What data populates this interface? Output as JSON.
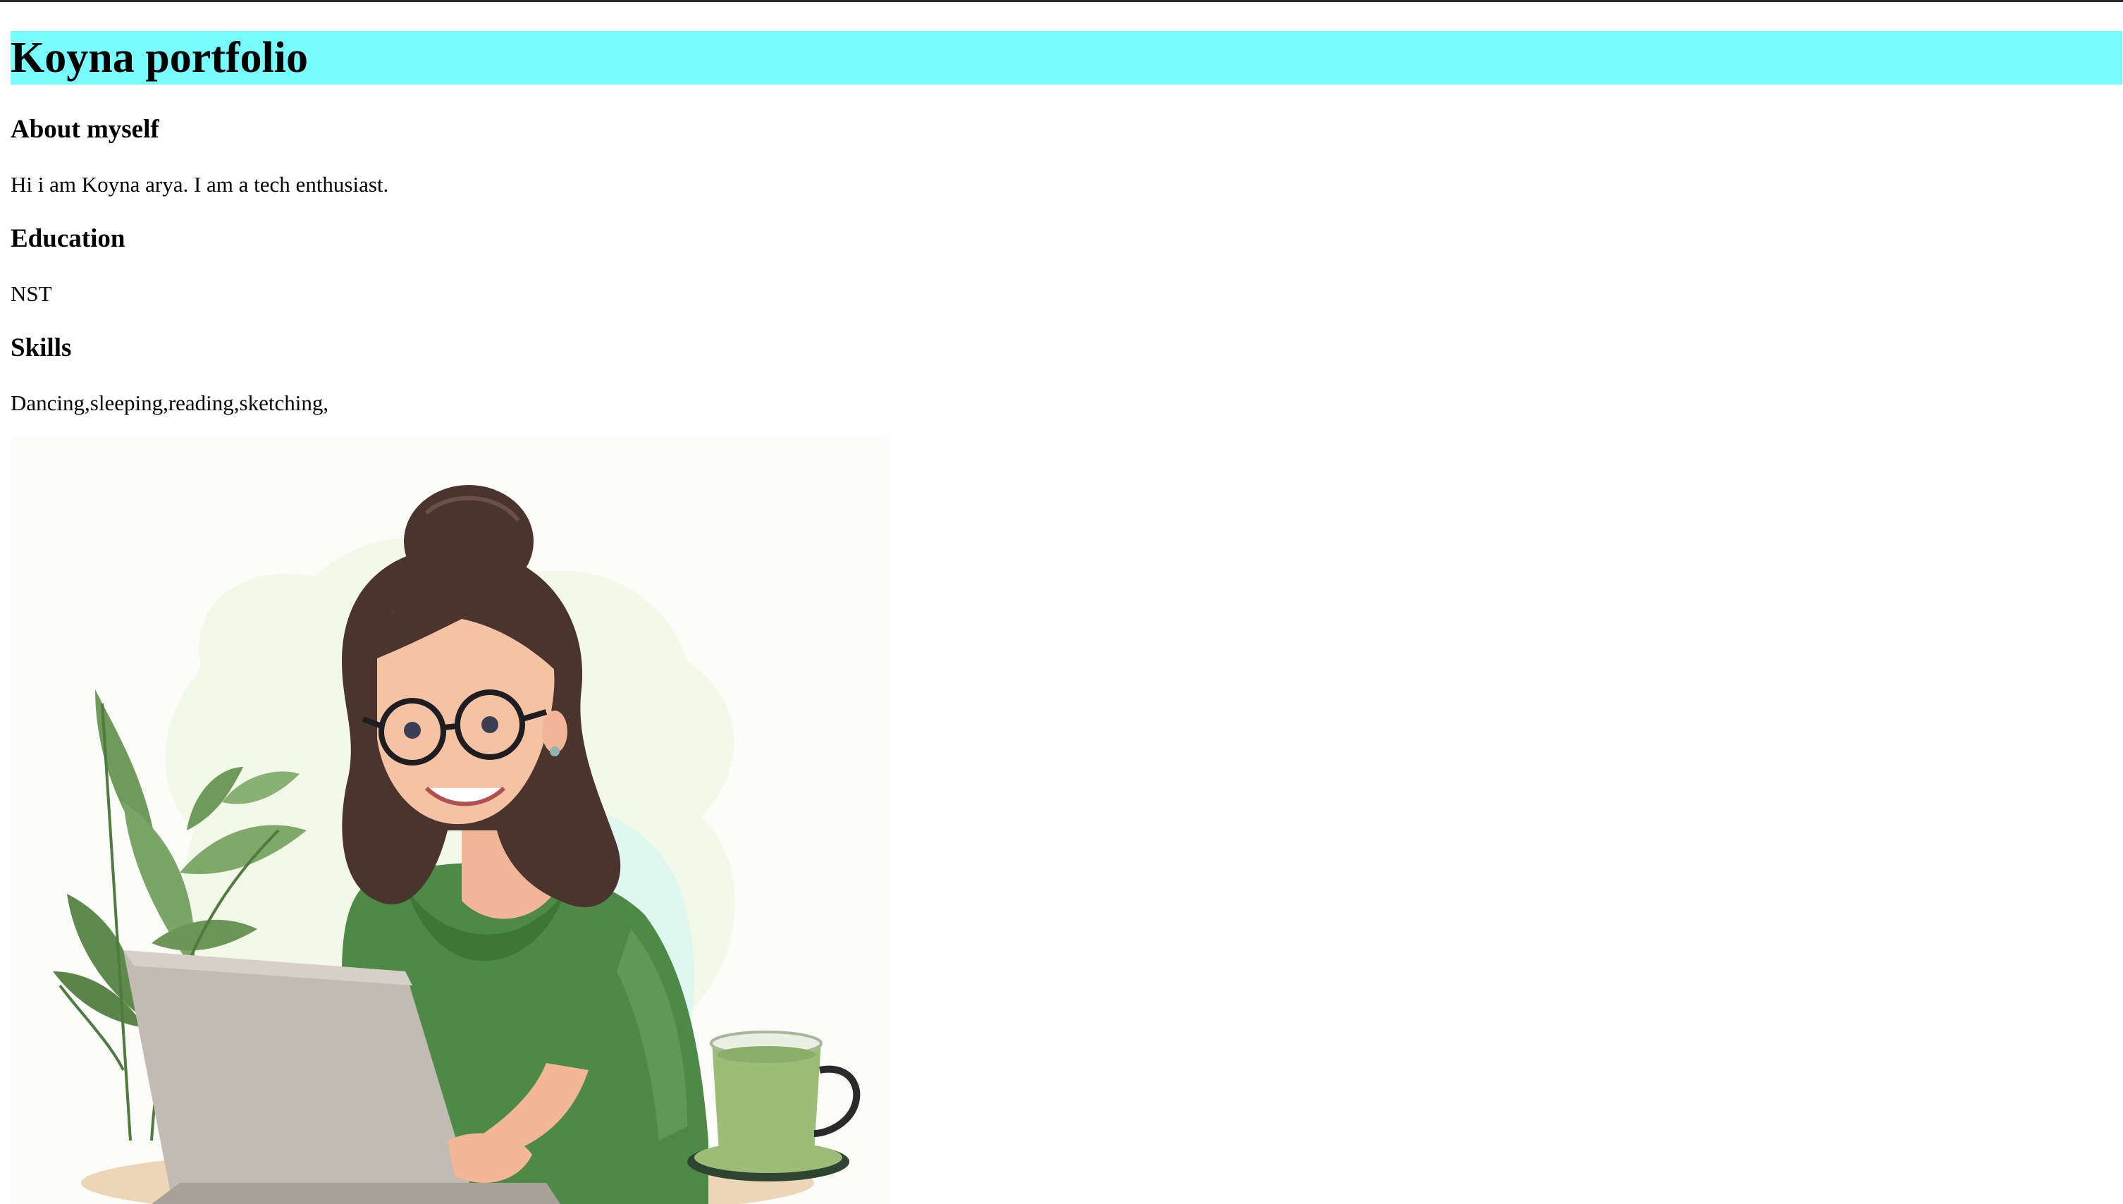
{
  "header": {
    "title": "Koyna portfolio"
  },
  "about": {
    "heading": "About myself",
    "text": "Hi i am Koyna arya. I am a tech enthusiast."
  },
  "education": {
    "heading": "Education",
    "text": "NST"
  },
  "skills": {
    "heading": "Skills",
    "text": "Dancing,sleeping,reading,sketching,"
  },
  "illustration": {
    "subject": "woman with glasses working on laptop with plant and green tea cup",
    "colors": {
      "header_bg": "#77fdfb",
      "shirt": "#4e8a47",
      "hair": "#4a342d",
      "laptop": "#c2bbb2",
      "tea": "#9bbd78"
    }
  }
}
